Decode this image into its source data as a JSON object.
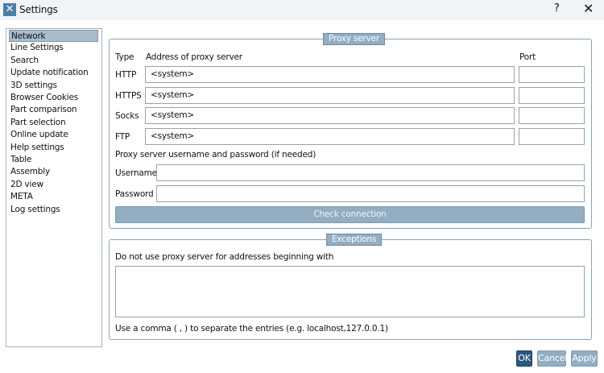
{
  "window": {
    "title": "Settings",
    "help": "?",
    "close": "✕",
    "icon": "tools-icon"
  },
  "sidebar": {
    "items": [
      "Network",
      "Line Settings",
      "Search",
      "Update notification",
      "3D settings",
      "Browser Cookies",
      "Part comparison",
      "Part selection",
      "Online update",
      "Help settings",
      "Table",
      "Assembly",
      "2D view",
      "META",
      "Log settings"
    ],
    "selected": "Network"
  },
  "proxy": {
    "title": "Proxy server",
    "col_type": "Type",
    "col_address": "Address of proxy server",
    "col_port": "Port",
    "rows": [
      {
        "type": "HTTP",
        "address": "<system>",
        "port": ""
      },
      {
        "type": "HTTPS",
        "address": "<system>",
        "port": ""
      },
      {
        "type": "Socks",
        "address": "<system>",
        "port": ""
      },
      {
        "type": "FTP",
        "address": "<system>",
        "port": ""
      }
    ],
    "auth_label": "Proxy server username and password (if needed)",
    "username_label": "Username",
    "username": "",
    "password_label": "Password",
    "password": "",
    "check_button": "Check connection"
  },
  "exceptions": {
    "title": "Exceptions",
    "description": "Do not use proxy server for addresses beginning with",
    "value": "",
    "note": "Use a comma ( , ) to separate the entries (e.g. localhost,127.0.0.1)"
  },
  "buttons": {
    "ok": "OK",
    "cancel": "Cancel",
    "apply": "Apply"
  }
}
